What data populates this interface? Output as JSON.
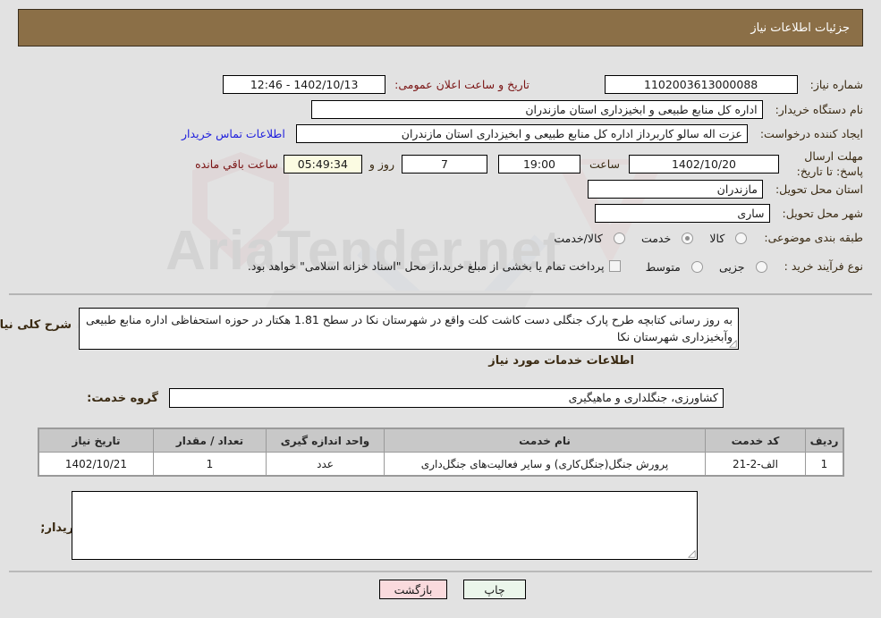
{
  "header": {
    "title": "جزئیات اطلاعات نیاز"
  },
  "form": {
    "need_number_label": "شماره نیاز:",
    "need_number_value": "1102003613000088",
    "announce_label": "تاریخ و ساعت اعلان عمومی:",
    "announce_value": "1402/10/13 - 12:46",
    "buyer_org_label": "نام دستگاه خریدار:",
    "buyer_org_value": "اداره کل منابع طبیعی و ابخیزداری استان مازندران",
    "creator_label": "ایجاد کننده درخواست:",
    "creator_value": "عزت اله سالو کاربرداز اداره کل منابع طبیعی و ابخیزداری استان مازندران",
    "contact_link": "اطلاعات تماس خریدار",
    "deadline_label": "مهلت ارسال پاسخ: تا تاریخ:",
    "deadline_date": "1402/10/20",
    "deadline_hour_label": "ساعت",
    "deadline_hour": "19:00",
    "remaining_days": "7",
    "remaining_days_label": "روز و",
    "remaining_time": "05:49:34",
    "remaining_time_label": "ساعت باقي مانده",
    "province_label": "استان محل تحویل:",
    "province_value": "مازندران",
    "city_label": "شهر محل تحویل:",
    "city_value": "ساری",
    "category_label": "طبقه بندی موضوعی:",
    "category_options": [
      {
        "label": "کالا",
        "selected": false
      },
      {
        "label": "خدمت",
        "selected": true
      },
      {
        "label": "کالا/خدمت",
        "selected": false
      }
    ],
    "process_label": "نوع فرآیند خرید :",
    "process_options": [
      {
        "label": "جزیی",
        "selected": false
      },
      {
        "label": "متوسط",
        "selected": false
      }
    ],
    "treasury_note": "پرداخت تمام یا بخشی از مبلغ خرید،از محل \"اسناد خزانه اسلامی\" خواهد بود.",
    "treasury_checked": false
  },
  "description": {
    "label": "شرح کلی نیاز:",
    "value": "به روز رسانی کتابچه طرح پارک جنگلی دست کاشت کلت واقع در شهرستان نکا در سطح 1.81 هکتار در حوزه استحفاظی اداره منابع طبیعی وآبخیزداری شهرستان نکا"
  },
  "services_section": {
    "heading": "اطلاعات خدمات مورد نیاز",
    "group_label": "گروه خدمت:",
    "group_value": "کشاورزی، جنگلداری و ماهیگیری"
  },
  "table": {
    "columns": [
      "ردیف",
      "کد خدمت",
      "نام خدمت",
      "واحد اندازه گیری",
      "تعداد / مقدار",
      "تاریخ نیاز"
    ],
    "rows": [
      {
        "row_no": "1",
        "service_code": "الف-2-21",
        "service_name": "پرورش جنگل(جنگل‌کاری) و سایر فعالیت‌های جنگل‌داری",
        "unit": "عدد",
        "quantity": "1",
        "need_date": "1402/10/21"
      }
    ]
  },
  "buyer_notes": {
    "label": "توضیحات خریدار;",
    "value": ""
  },
  "footer": {
    "print_label": "چاپ",
    "back_label": "بازگشت"
  },
  "watermark": {
    "text": "AriaTender.net"
  },
  "colors": {
    "header_bg": "#8b6f47",
    "link": "#2020dd",
    "label": "#3a2a12",
    "label_red": "#7a1414",
    "print_btn": "#ebf6eb",
    "back_btn": "#fadadd",
    "countdown_bg": "#fbfbe2"
  }
}
